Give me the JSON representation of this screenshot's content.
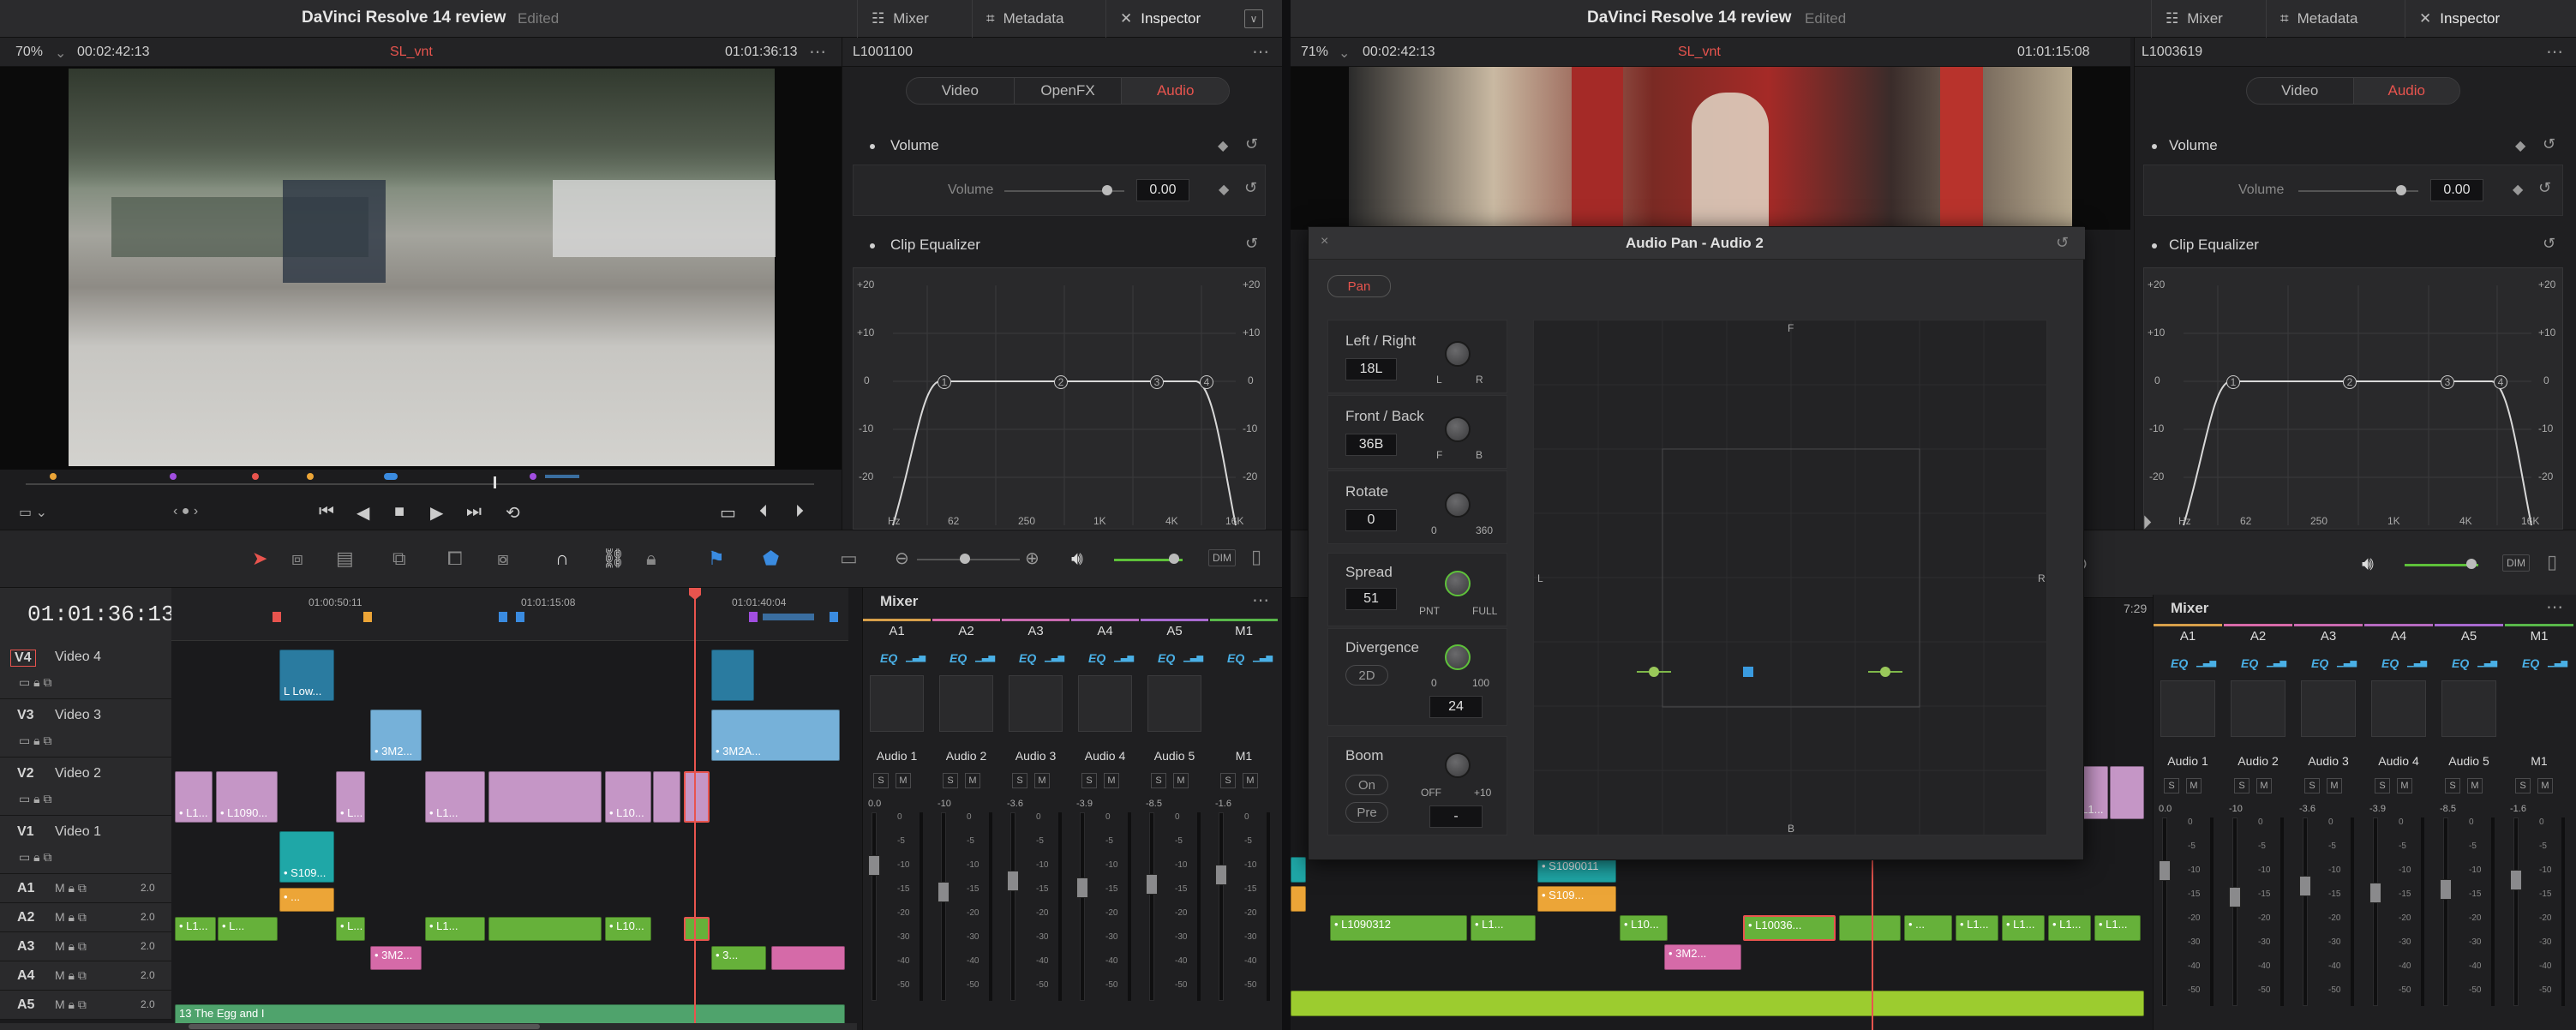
{
  "left": {
    "title": "DaVinci Resolve 14 review",
    "edited": "Edited",
    "tabs": [
      {
        "label": "Mixer"
      },
      {
        "label": "Metadata"
      },
      {
        "label": "Inspector"
      }
    ],
    "viewer": {
      "zoom": "70%",
      "duration": "00:02:42:13",
      "clip_name": "SL_vnt",
      "timecode": "01:01:36:13"
    },
    "inspector": {
      "clip_id": "L1001100",
      "tabs": [
        "Video",
        "OpenFX",
        "Audio"
      ],
      "volume_section": "Volume",
      "volume_label": "Volume",
      "volume_value": "0.00",
      "eq_section": "Clip Equalizer",
      "eq_y_ticks": [
        "+20",
        "+10",
        "0",
        "-10",
        "-20"
      ],
      "eq_x_ticks": [
        "Hz",
        "62",
        "250",
        "1K",
        "4K",
        "16K"
      ],
      "eq_bands": [
        "1",
        "2",
        "3",
        "4"
      ]
    },
    "timeline": {
      "timecode": "01:01:36:13",
      "ruler": [
        "01:00:50:11",
        "01:01:15:08",
        "01:01:40:04"
      ],
      "tracks": [
        {
          "id": "V4",
          "name": "Video 4"
        },
        {
          "id": "V3",
          "name": "Video 3"
        },
        {
          "id": "V2",
          "name": "Video 2"
        },
        {
          "id": "V1",
          "name": "Video 1"
        },
        {
          "id": "A1",
          "vol": "2.0"
        },
        {
          "id": "A2",
          "vol": "2.0"
        },
        {
          "id": "A3",
          "vol": "2.0"
        },
        {
          "id": "A4",
          "vol": "2.0"
        },
        {
          "id": "A5",
          "vol": "2.0"
        }
      ],
      "clips": {
        "v4": "L Low...",
        "v3": "• 3M2...",
        "v3b": "• 3M2A...",
        "v2a": "• L1...",
        "v2b": "• L1090...",
        "v2c": "• L...",
        "v2d": "• L1...",
        "v2e": "• L10...",
        "v1": "• S109...",
        "a1": "• ...",
        "a2a": "• L1...",
        "a2b": "• L...",
        "a2c": "• L...",
        "a2d": "• L1...",
        "a2e": "• L10...",
        "a3": "• 3M2...",
        "a3b": "• 3...",
        "a5": "13 The Egg and I"
      }
    },
    "mixer": {
      "title": "Mixer",
      "channels": [
        "A1",
        "A2",
        "A3",
        "A4",
        "A5",
        "M1"
      ],
      "eq": [
        "EQ",
        "EQ",
        "EQ",
        "EQ",
        "EQ",
        "EQ"
      ],
      "names": [
        "Audio 1",
        "Audio 2",
        "Audio 3",
        "Audio 4",
        "Audio 5",
        "M1"
      ],
      "levels": [
        "0.0",
        "-10",
        "-3.6",
        "-3.9",
        "-8.5",
        "-1.6"
      ],
      "scale": [
        "0",
        "-5",
        "-10",
        "-15",
        "-20",
        "-30",
        "-40",
        "-50"
      ]
    }
  },
  "right": {
    "title": "DaVinci Resolve 14 review",
    "edited": "Edited",
    "tabs": [
      {
        "label": "Mixer"
      },
      {
        "label": "Metadata"
      },
      {
        "label": "Inspector"
      }
    ],
    "viewer": {
      "zoom": "71%",
      "duration": "00:02:42:13",
      "clip_name": "SL_vnt",
      "timecode": "01:01:15:08"
    },
    "inspector": {
      "clip_id": "L1003619",
      "tabs": [
        "Video",
        "Audio"
      ],
      "volume_section": "Volume",
      "volume_label": "Volume",
      "volume_value": "0.00",
      "eq_section": "Clip Equalizer",
      "eq_y_ticks": [
        "+20",
        "+10",
        "0",
        "-10",
        "-20"
      ],
      "eq_x_ticks": [
        "Hz",
        "62",
        "250",
        "1K",
        "4K",
        "16K"
      ],
      "eq_bands": [
        "1",
        "2",
        "3",
        "4"
      ]
    },
    "pan": {
      "title": "Audio Pan - Audio 2",
      "pan_label": "Pan",
      "left_right": "Left / Right",
      "lr_value": "18L",
      "lr_l": "L",
      "lr_r": "R",
      "front_back": "Front / Back",
      "fb_value": "36B",
      "fb_f": "F",
      "fb_b": "B",
      "rotate": "Rotate",
      "rotate_value": "0",
      "rot_min": "0",
      "rot_max": "360",
      "spread": "Spread",
      "spread_value": "51",
      "spread_min": "PNT",
      "spread_max": "FULL",
      "divergence": "Divergence",
      "div_2d": "2D",
      "div_min": "0",
      "div_max": "100",
      "div_value": "24",
      "boom": "Boom",
      "boom_on": "On",
      "boom_pre": "Pre",
      "boom_off": "OFF",
      "boom_max": "+10",
      "boom_value": "-",
      "axis_f": "F",
      "axis_b": "B",
      "axis_l": "L",
      "axis_r": "R"
    },
    "timeline": {
      "ruler_fragment": "7:29",
      "clips": {
        "s1": "• S1090011",
        "s2": "• S109...",
        "a1": "• L1090312",
        "a2": "• L1...",
        "a3": "• L10...",
        "a4": "• L10036...",
        "a5": "• ...",
        "a6": "• L1...",
        "a7": "• L1...",
        "a8": "• L1...",
        "a9": "• L1...",
        "pink": "• 3M2...",
        "v": "• L1..."
      }
    },
    "mixer": {
      "title": "Mixer",
      "channels": [
        "A1",
        "A2",
        "A3",
        "A4",
        "A5",
        "M1"
      ],
      "eq": [
        "EQ",
        "EQ",
        "EQ",
        "EQ",
        "EQ",
        "EQ"
      ],
      "names": [
        "Audio 1",
        "Audio 2",
        "Audio 3",
        "Audio 4",
        "Audio 5",
        "M1"
      ],
      "levels": [
        "0.0",
        "-10",
        "-3.6",
        "-3.9",
        "-8.5",
        "-1.6"
      ],
      "scale": [
        "0",
        "-5",
        "-10",
        "-15",
        "-20",
        "-30",
        "-40",
        "-50"
      ]
    }
  },
  "colors": {
    "accent_red": "#e8544e",
    "eq_blue": "#4ab0e6",
    "clip_violet": "#c596c6",
    "clip_audio_green": "#66b13a",
    "clip_orange": "#eca537",
    "clip_pink": "#d56aa8",
    "clip_teal": "#1fa7a7"
  }
}
